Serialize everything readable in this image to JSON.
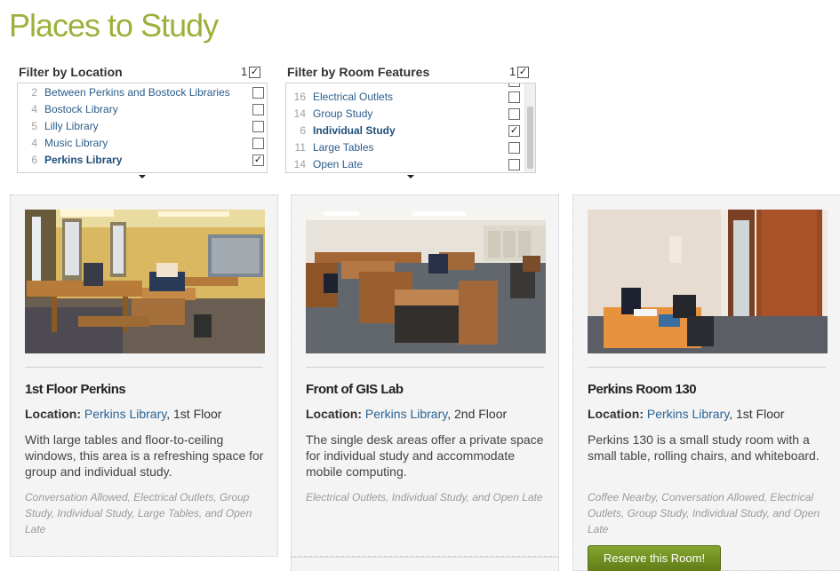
{
  "page": {
    "title": "Places to Study"
  },
  "filters": {
    "location": {
      "title": "Filter by Location",
      "selected_count": "1",
      "all_check": "✓",
      "items": [
        {
          "count": "2",
          "label": "Between Perkins and Bostock Libraries",
          "check": ""
        },
        {
          "count": "4",
          "label": "Bostock Library",
          "check": ""
        },
        {
          "count": "5",
          "label": "Lilly Library",
          "check": ""
        },
        {
          "count": "4",
          "label": "Music Library",
          "check": ""
        },
        {
          "count": "6",
          "label": "Perkins Library",
          "check": "✓"
        }
      ]
    },
    "features": {
      "title": "Filter by Room Features",
      "selected_count": "1",
      "all_check": "✓",
      "items": [
        {
          "count": "16",
          "label": "Electrical Outlets",
          "check": ""
        },
        {
          "count": "14",
          "label": "Group Study",
          "check": ""
        },
        {
          "count": "6",
          "label": "Individual Study",
          "check": "✓"
        },
        {
          "count": "11",
          "label": "Large Tables",
          "check": ""
        },
        {
          "count": "14",
          "label": "Open Late",
          "check": ""
        }
      ]
    }
  },
  "cards": [
    {
      "title": "1st Floor Perkins",
      "location_label": "Location:",
      "location_link": "Perkins Library",
      "location_rest": ", 1st Floor",
      "description": "With large tables and floor-to-ceiling windows, this area is a refreshing space for group and individual study.",
      "tags": "Conversation Allowed, Electrical Outlets, Group Study, Individual Study, Large Tables, and Open Late"
    },
    {
      "title": "Front of GIS Lab",
      "location_label": "Location:",
      "location_link": "Perkins Library",
      "location_rest": ", 2nd Floor",
      "description": "The single desk areas offer a private space for individual study and accommodate mobile computing.",
      "tags": "Electrical Outlets, Individual Study, and Open Late"
    },
    {
      "title": "Perkins Room 130",
      "location_label": "Location:",
      "location_link": "Perkins Library",
      "location_rest": ", 1st Floor",
      "description": "Perkins 130 is a small study room with a small table, rolling chairs, and whiteboard.",
      "tags": "Coffee Nearby, Conversation Allowed, Electrical Outlets, Group Study, Individual Study, and Open Late",
      "button": "Reserve this Room!"
    }
  ],
  "colors": {
    "title_green": "#9ab23c",
    "link_blue": "#2a6496",
    "button_green": "#6f8f1f"
  }
}
